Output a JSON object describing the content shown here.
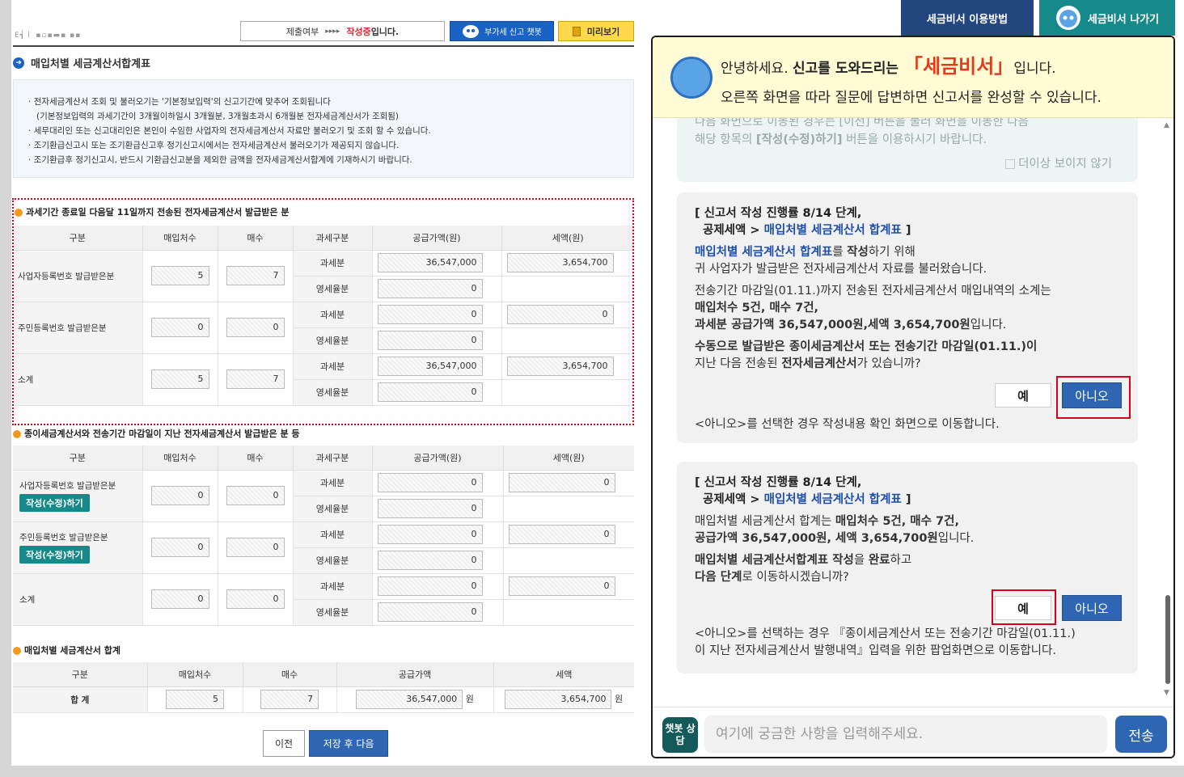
{
  "left": {
    "logo_text": "E┪ㅣ ▪▫▪▬▪ ▪▪",
    "status": {
      "label": "제출여부",
      "arrows": "▸▸▸▸",
      "state": "작성중",
      "suffix": "입니다."
    },
    "chatbot_button": "부가세 신고 챗봇",
    "preview_button": "미리보기",
    "section_title": "매입처별 세금계산서합계표",
    "notices": [
      "전자세금계산서 조회 및 불러오기는 '기본정보입력'의 신고기간에 맞추어 조회됩니다",
      "(기본정보입력의 과세기간이 3개월이하일시 3개월분, 3개월초과시 6개월분 전자세금계산서가 조회됨)",
      "세무대리인 또는 신고대리인은 본인이 수임한 사업자의 전자세금계산서 자료만 불러오기 및 조회 할 수 있습니다.",
      "조기환급신고시 또는 조기환급신고후 정기신고시에서는 전자세금계산서 불러오기가 제공되지 않습니다.",
      "조기환급후 정기신고시, 반드시 기환급신고분을 제외한 금액을 전자세금계산서합계에 기재하시기 바랍니다."
    ],
    "table1": {
      "title": "과세기간 종료일 다음달 11일까지 전송된 전자세금계산서 발급받은 분",
      "headers": [
        "구분",
        "매입처수",
        "매수",
        "과세구분",
        "공급가액(원)",
        "세액(원)"
      ],
      "rows": [
        {
          "label": "사업자등록번호 발급받은분",
          "vendors": "5",
          "count": "7",
          "taxable_label": "과세분",
          "taxable_supply": "36,547,000",
          "taxable_tax": "3,654,700",
          "zero_label": "영세율분",
          "zero_supply": "0"
        },
        {
          "label": "주민등록번호 발급받은분",
          "vendors": "0",
          "count": "0",
          "taxable_label": "과세분",
          "taxable_supply": "0",
          "taxable_tax": "0",
          "zero_label": "영세율분",
          "zero_supply": "0"
        },
        {
          "label": "소계",
          "vendors": "5",
          "count": "7",
          "taxable_label": "과세분",
          "taxable_supply": "36,547,000",
          "taxable_tax": "3,654,700",
          "zero_label": "영세율분",
          "zero_supply": "0"
        }
      ]
    },
    "table2": {
      "title": "종이세금계산서와 전송기간 마감일이 지난 전자세금계산서 발급받은 분 등",
      "headers": [
        "구분",
        "매입처수",
        "매수",
        "과세구분",
        "공급가액(원)",
        "세액(원)"
      ],
      "edit_button": "작성(수정)하기",
      "rows": [
        {
          "label": "사업자등록번호 발급받은분",
          "vendors": "0",
          "count": "0",
          "taxable_label": "과세분",
          "taxable_supply": "0",
          "taxable_tax": "0",
          "zero_label": "영세율분",
          "zero_supply": "0"
        },
        {
          "label": "주민등록번호 발급받은분",
          "vendors": "0",
          "count": "0",
          "taxable_label": "과세분",
          "taxable_supply": "0",
          "taxable_tax": "0",
          "zero_label": "영세율분",
          "zero_supply": "0"
        },
        {
          "label": "소계",
          "vendors": "0",
          "count": "0",
          "taxable_label": "과세분",
          "taxable_supply": "0",
          "taxable_tax": "0",
          "zero_label": "영세율분",
          "zero_supply": "0"
        }
      ]
    },
    "table3": {
      "title": "매입처별 세금계산서 합계",
      "headers": [
        "구분",
        "매입처수",
        "매수",
        "공급가액",
        "세액"
      ],
      "row": {
        "label": "합 계",
        "vendors": "5",
        "count": "7",
        "supply": "36,547,000",
        "tax": "3,654,700",
        "unit": "원"
      }
    },
    "prev_button": "이전",
    "next_button": "저장 후 다음"
  },
  "right": {
    "guide_button": "세금비서 이용방법",
    "exit_button": "세금비서 나가기",
    "greeting": {
      "hello": "안녕하세요. ",
      "bold": "신고를 도와드리는 ",
      "brand": "「세금비서」",
      "tail": "입니다.",
      "line2": "오른쪽 화면을 따라 질문에 답변하면 신고서를 완성할 수 있습니다."
    },
    "faded": {
      "line1": "다음 화면으로 이동된 경우는 [이전] 버튼을 눌러 화면을 이동한 다음",
      "line2a": "해당 항목의 ",
      "line2b": "[작성(수정)하기]",
      "line2c": " 버튼을 이용하시기 바랍니다.",
      "dont_show": "더이상 보이지 않기"
    },
    "msg1": {
      "step": "[ 신고서 작성 진행률 8/14 단계,",
      "crumb_a": "공제세액 > ",
      "crumb_b": "매입처별 세금계산서 합계표",
      "crumb_c": " ]",
      "p1a": "매입처별 세금계산서 합계표",
      "p1b": "를 ",
      "p1c": "작성",
      "p1d": "하기 위해",
      "p1e": "귀 사업자가 발급받은 전자세금계산서 자료를 불러왔습니다.",
      "p2a": "전송기간 마감일(01.11.)까지 전송된 전자세금계산서 매입내역의 소계는",
      "p2b": "매입처수 5건, 매수 7건,",
      "p2c": "과세분 공급가액 36,547,000원,세액 3,654,700원",
      "p2d": "입니다.",
      "p3a": "수동으로 발급받은 종이세금계산서 또는 ",
      "p3b": "전송기간 마감일(01.11.)",
      "p3c": "이",
      "p3d": "지난 다음 전송된 ",
      "p3e": "전자세금계산서",
      "p3f": "가 있습니까?",
      "yes": "예",
      "no": "아니오",
      "note": "<아니오>를 선택한 경우 작성내용 확인 화면으로 이동합니다."
    },
    "msg2": {
      "step": "[ 신고서 작성 진행률 8/14 단계,",
      "crumb_a": "공제세액 > ",
      "crumb_b": "매입처별 세금계산서 합계표",
      "crumb_c": " ]",
      "p1a": "매입처별 세금계산서 합계는 ",
      "p1b": "매입처수 5건, 매수 7건,",
      "p1c": "공급가액 36,547,000원, 세액 3,654,700원",
      "p1d": "입니다.",
      "p2a": "매입처별 세금계산서합계표 작성",
      "p2b": "을 ",
      "p2c": "완료",
      "p2d": "하고",
      "p2e": "다음 단계",
      "p2f": "로 이동하시겠습니까?",
      "yes": "예",
      "no": "아니오",
      "note1": "<아니오>를 선택하는 경우 『종이세금계산서 또는 전송기간 마감일(01.11.)",
      "note2": "이 지난 전자세금계산서 발행내역』입력을 위한 팝업화면으로 이동합니다."
    },
    "bot_consult": "챗봇 상담",
    "input_placeholder": "여기에 궁금한 사항을 입력해주세요.",
    "send": "전송"
  }
}
